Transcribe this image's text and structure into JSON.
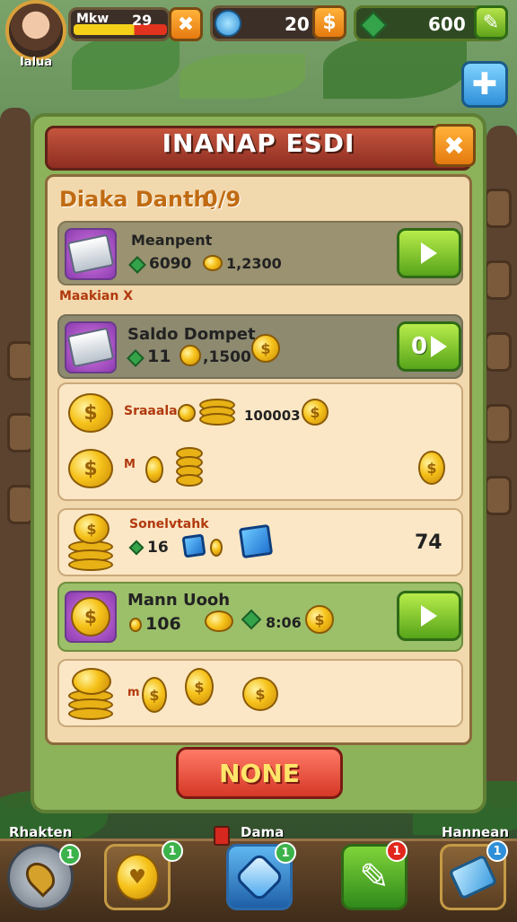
{
  "hud": {
    "player_name": "Ialua",
    "hp_label": "Mkw",
    "hp_value": "29",
    "coins": "20",
    "gems": "600",
    "colors": {
      "hp_yellow": "#f4d019",
      "hp_red": "#e2331e",
      "accent_orange": "#e57a10",
      "accent_green": "#5fa31b"
    }
  },
  "panel": {
    "title": "INANAP ESDI",
    "summary_label": "Diaka Danth)",
    "summary_value": "0/9",
    "section_label": "Maakian X",
    "rows": [
      {
        "title": "Meanpent",
        "stat1": "6090",
        "stat2": "1,2300"
      },
      {
        "title": "Saldo Dompet",
        "stat1": "11",
        "stat2": ",1500",
        "button": "0"
      },
      {
        "label": "Sraaala",
        "value": "100003",
        "sub": "M"
      },
      {
        "label": "Sonelvtahk",
        "stat1": "16",
        "value": "74"
      },
      {
        "title": "Mann Uooh",
        "stat1": "106",
        "stat2": "8:06"
      },
      {
        "label": "m"
      }
    ],
    "bottom_button": "NONE"
  },
  "nav": {
    "left_label": "Rhakten",
    "middle_label": "Dama",
    "right_label": "Hannean",
    "badges": [
      "1",
      "1",
      "1",
      "1",
      "1"
    ]
  },
  "icons": [
    "close-icon",
    "plus-icon",
    "pencil-icon",
    "dollar-icon",
    "play-icon",
    "map-pin-icon",
    "heart-shield-icon",
    "crystal-icon",
    "pencil-icon",
    "puzzle-icon"
  ]
}
